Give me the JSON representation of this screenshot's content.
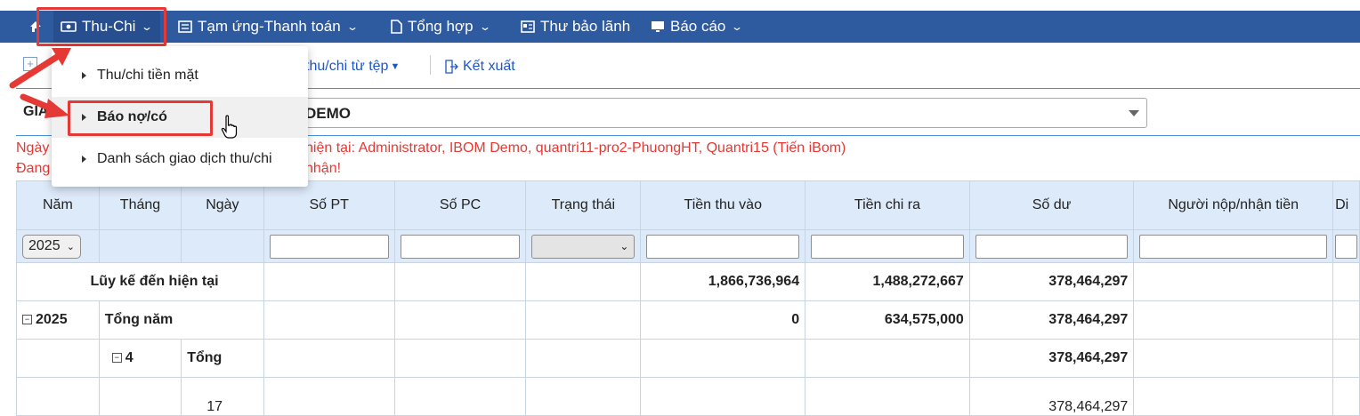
{
  "nav": {
    "thu_chi": "Thu-Chi",
    "tam_ung": "Tạm ứng-Thanh toán",
    "tong_hop": "Tổng hợp",
    "thu_bao_lanh": "Thư bảo lãnh",
    "bao_cao": "Báo cáo"
  },
  "toolbar": {
    "import_label": "thu/chi từ tệp",
    "export_label": "Kết xuất"
  },
  "filter": {
    "gia_label": "GIA",
    "company_value": "DEMO"
  },
  "notices": {
    "line1_prefix": "Ngày",
    "line1": "hiện tại: Administrator, IBOM Demo, quantri11-pro2-PhuongHT, Quantri15 (Tiến iBom)",
    "line2_prefix": "Đang",
    "line2": "nhận!"
  },
  "dropdown": {
    "items": [
      "Thu/chi tiền mặt",
      "Báo nợ/có",
      "Danh sách giao dịch thu/chi"
    ]
  },
  "table": {
    "headers": [
      "Năm",
      "Tháng",
      "Ngày",
      "Số PT",
      "Số PC",
      "Trạng thái",
      "Tiền thu vào",
      "Tiền chi ra",
      "Số dư",
      "Người nộp/nhận tiền",
      "Di"
    ],
    "year_filter": "2025",
    "rows": {
      "luy_ke": {
        "label": "Lũy kế đến hiện tại",
        "thu": "1,866,736,964",
        "chi": "1,488,272,667",
        "du": "378,464,297"
      },
      "nam": {
        "year": "2025",
        "label": "Tổng năm",
        "thu": "0",
        "chi": "634,575,000",
        "du": "378,464,297"
      },
      "thang": {
        "month": "4",
        "label": "Tổng",
        "du": "378,464,297"
      },
      "ngay": {
        "day": "17",
        "du": "378,464,297"
      }
    }
  },
  "colors": {
    "navbar": "#2e5aa0",
    "highlight": "#e53935",
    "link": "#1f56c9",
    "grid_header": "#ddeafa"
  }
}
